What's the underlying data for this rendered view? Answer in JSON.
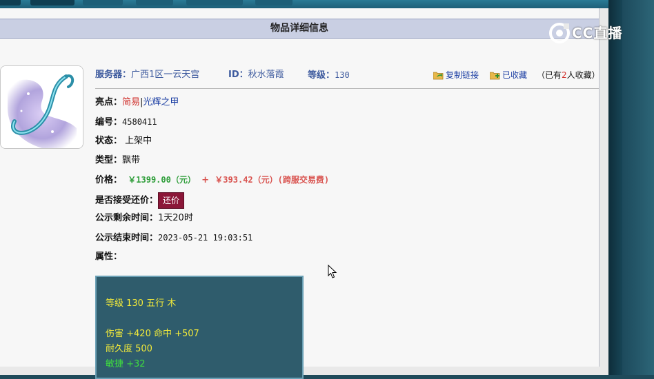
{
  "overlay": {
    "logo_text": "CC直播"
  },
  "page": {
    "title": "物品详细信息"
  },
  "header": {
    "server_label": "服务器：",
    "server_value": "广西1区一云天宫",
    "id_label": "ID：",
    "id_value": "秋水落霞",
    "level_label": "等级：",
    "level_value": "130",
    "copy_link": "复制链接",
    "favorited": "已收藏",
    "fav_prefix": "（已有",
    "fav_count": "2",
    "fav_suffix": "人收藏）"
  },
  "details": {
    "highlight_label": "亮点：",
    "highlight_1": "简易",
    "highlight_sep": "|",
    "highlight_2": "光辉之甲",
    "number_label": "编号：",
    "number_value": "4580411",
    "status_label": "状态：",
    "status_value": "上架中",
    "type_label": "类型：",
    "type_value": "飘带",
    "price_label": "价格：",
    "price_value": "￥1399.00（元）",
    "price_plus": "+",
    "fee_value": "￥393.42（元）(跨服交易费)",
    "counter_label": "是否接受还价：",
    "counter_button": "还价",
    "remaining_label": "公示剩余时间：",
    "remaining_value": "1天20时",
    "end_label": "公示结束时间：",
    "end_value": "2023-05-21 19:03:51",
    "attr_label": "属性："
  },
  "attributes": {
    "line1": "等级 130 五行 木",
    "line2": "伤害 +420 命中 +507",
    "line3": "耐久度 500",
    "line4": "敏捷 +32"
  },
  "colors": {
    "title_bg": "#c9cfe3",
    "counter_btn": "#8b1738",
    "attr_bg": "#2f5c6c",
    "price_green": "#2f9e3a",
    "price_red": "#d0312d"
  }
}
